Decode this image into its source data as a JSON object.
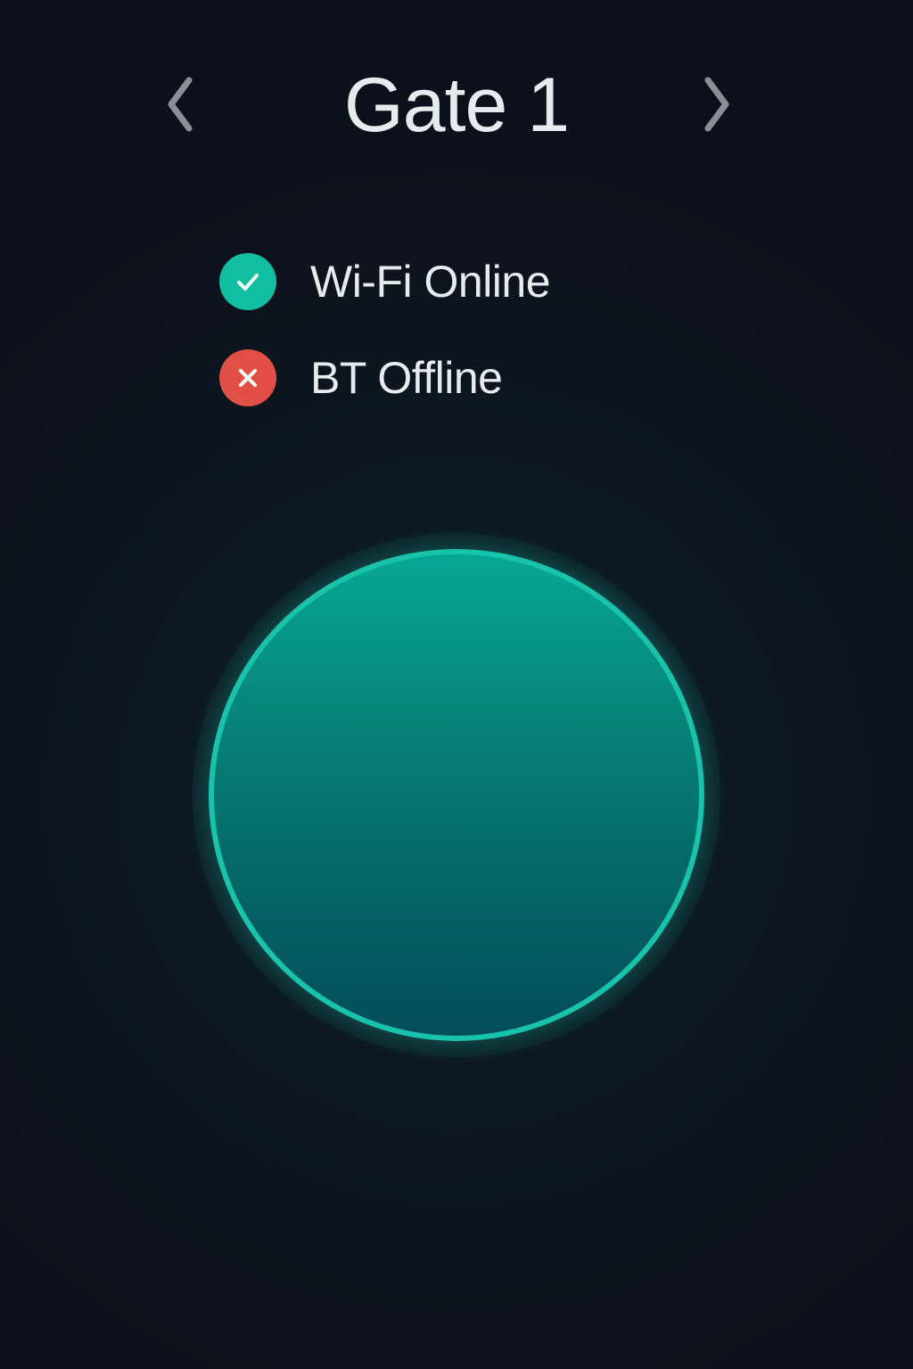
{
  "header": {
    "title": "Gate 1",
    "prev_icon": "chevron-left-icon",
    "next_icon": "chevron-right-icon"
  },
  "status": {
    "items": [
      {
        "label": "Wi-Fi Online",
        "state": "ok",
        "icon": "check-circle-icon",
        "color": "#10bfa1"
      },
      {
        "label": "BT Offline",
        "state": "error",
        "icon": "x-circle-icon",
        "color": "#e24f46"
      }
    ]
  },
  "action_button": {
    "color": "#19c2aa"
  },
  "colors": {
    "background": "#0c121b",
    "text": "#e7ebee",
    "chevron": "#8a8f96"
  }
}
